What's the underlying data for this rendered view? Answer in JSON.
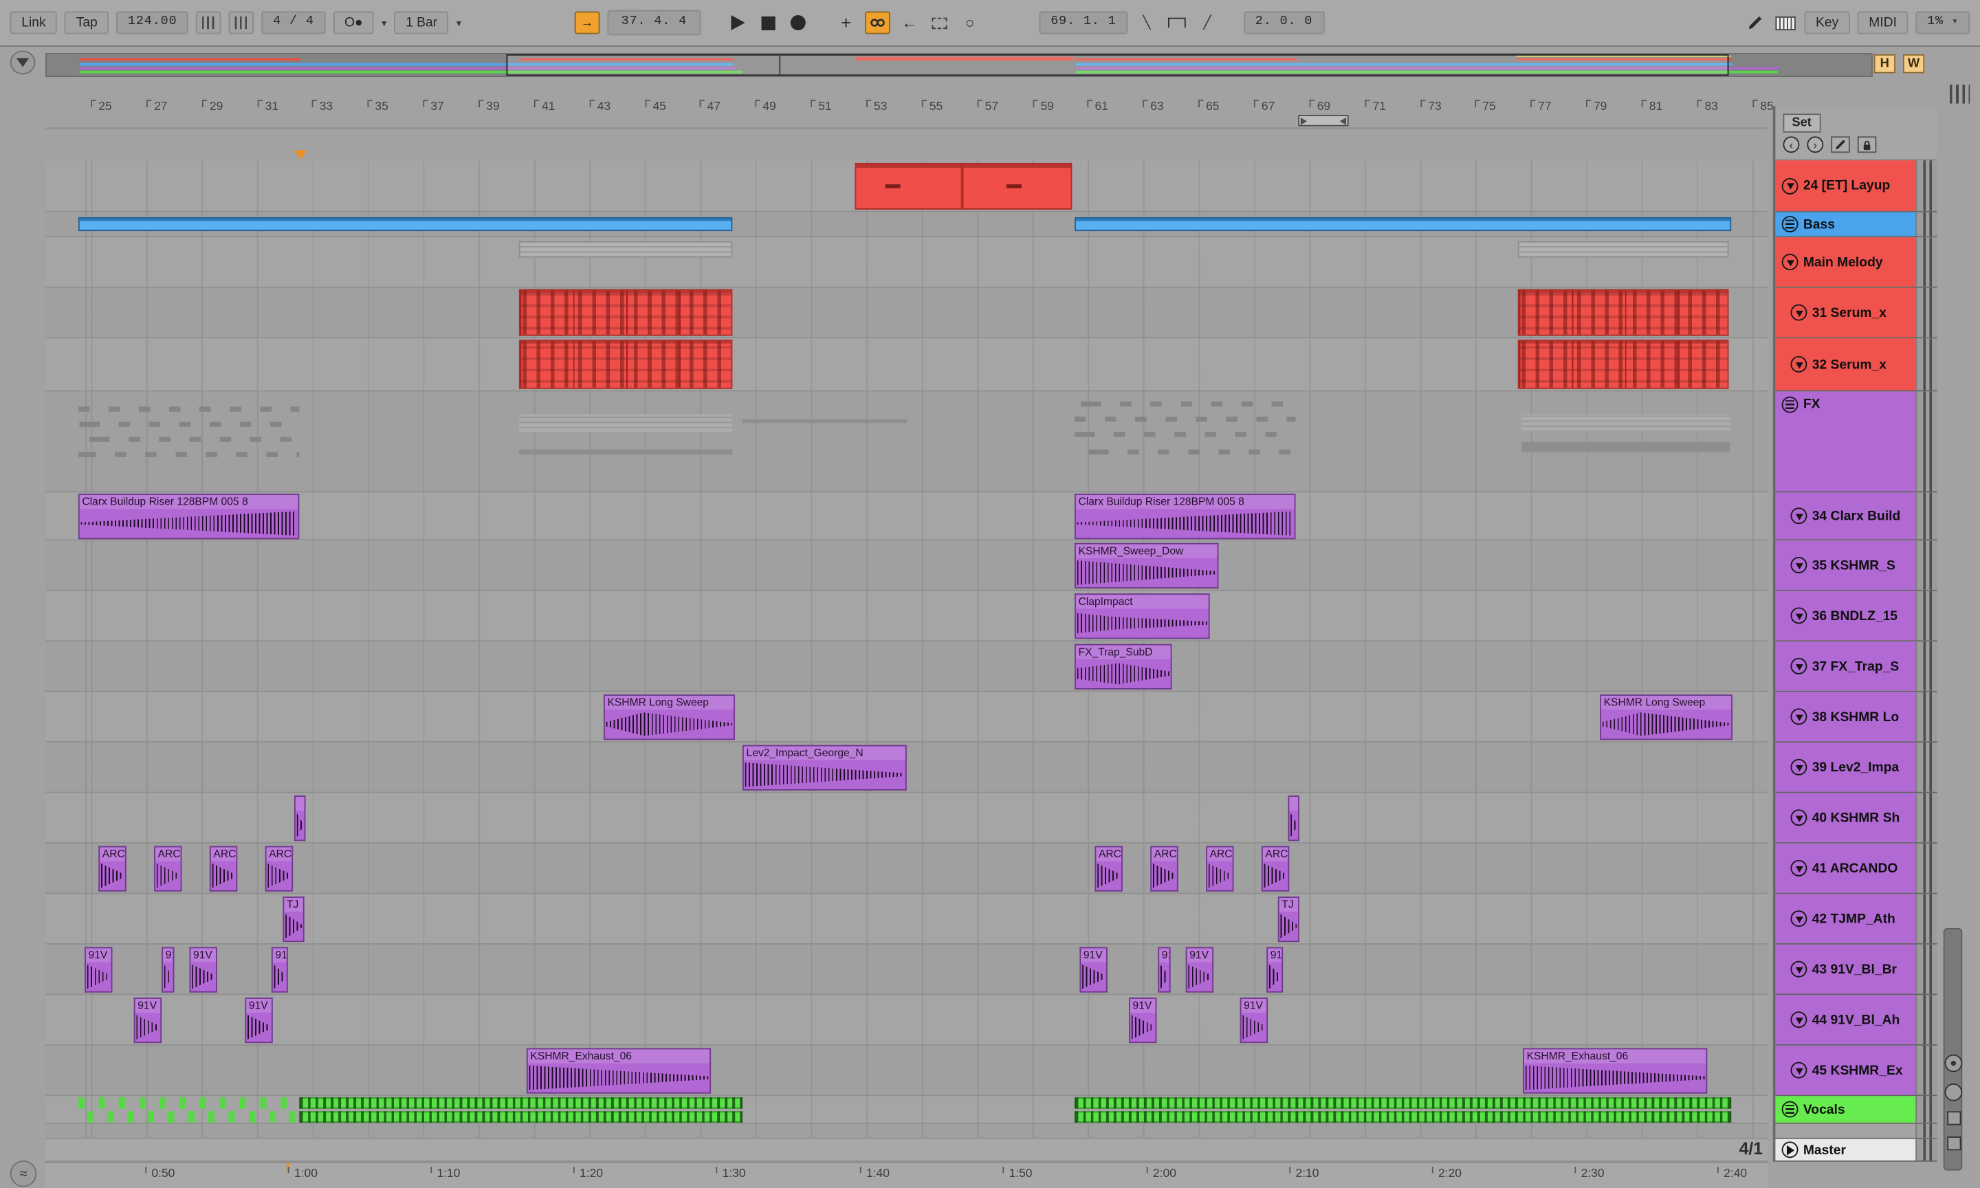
{
  "toolbar": {
    "link_label": "Link",
    "tap_label": "Tap",
    "tempo": "124.00",
    "time_signature": "4 / 4",
    "groove_label": "O●",
    "quantize_label": "1 Bar",
    "arrangement_position": "37. 4. 4",
    "loop_start": "69. 1. 1",
    "loop_length": "2. 0. 0",
    "key_label": "Key",
    "midi_label": "MIDI",
    "cpu_load": "1%"
  },
  "overview": {
    "h_label": "H",
    "w_label": "W"
  },
  "set_panel": {
    "set_label": "Set"
  },
  "bar_ruler": [
    "25",
    "27",
    "29",
    "31",
    "33",
    "35",
    "37",
    "39",
    "41",
    "43",
    "45",
    "47",
    "49",
    "51",
    "53",
    "55",
    "57",
    "59",
    "61",
    "63",
    "65",
    "67",
    "69",
    "71",
    "73",
    "75",
    "77",
    "79",
    "81",
    "83",
    "85"
  ],
  "tracks": [
    {
      "name": "24 [ET] Layup",
      "color": "#f0534e"
    },
    {
      "name": "Bass",
      "color": "#4aa3ec"
    },
    {
      "name": "Main Melody",
      "color": "#f0534e"
    },
    {
      "name": "31 Serum_x",
      "color": "#f0534e"
    },
    {
      "name": "32 Serum_x",
      "color": "#f0534e"
    },
    {
      "name": "FX",
      "color": "#b169d3"
    },
    {
      "name": "34 Clarx Build",
      "color": "#b169d3"
    },
    {
      "name": "35 KSHMR_S",
      "color": "#b169d3"
    },
    {
      "name": "36 BNDLZ_15",
      "color": "#b169d3"
    },
    {
      "name": "37 FX_Trap_S",
      "color": "#b169d3"
    },
    {
      "name": "38 KSHMR Lo",
      "color": "#b169d3"
    },
    {
      "name": "39 Lev2_Impa",
      "color": "#b169d3"
    },
    {
      "name": "40 KSHMR Sh",
      "color": "#b169d3"
    },
    {
      "name": "41 ARCANDO",
      "color": "#b169d3"
    },
    {
      "name": "42 TJMP_Ath",
      "color": "#b169d3"
    },
    {
      "name": "43 91V_Bl_Br",
      "color": "#b169d3"
    },
    {
      "name": "44 91V_Bl_Ah",
      "color": "#b169d3"
    },
    {
      "name": "45 KSHMR_Ex",
      "color": "#b169d3"
    },
    {
      "name": "Vocals",
      "color": "#67ec50"
    },
    {
      "name": "Master",
      "color": "#e9e9e9"
    }
  ],
  "clips": {
    "clarx": "Clarx Buildup Riser 128BPM 005 8",
    "sweep_down": "KSHMR_Sweep_Dow",
    "clap": "ClapImpact",
    "subdrop": "FX_Trap_SubD",
    "long_sweep": "KSHMR Long Sweep",
    "lev2": "Lev2_Impact_George_N",
    "arca": "ARCA",
    "tj": "TJ",
    "v91": "91V",
    "v91_short": "91",
    "exhaust": "KSHMR_Exhaust_06"
  },
  "time_ruler": {
    "labels": [
      "0:50",
      "1:00",
      "1:10",
      "1:20",
      "1:30",
      "1:40",
      "1:50",
      "2:00",
      "2:10",
      "2:20",
      "2:30",
      "2:40"
    ],
    "grid_label": "4/1"
  }
}
